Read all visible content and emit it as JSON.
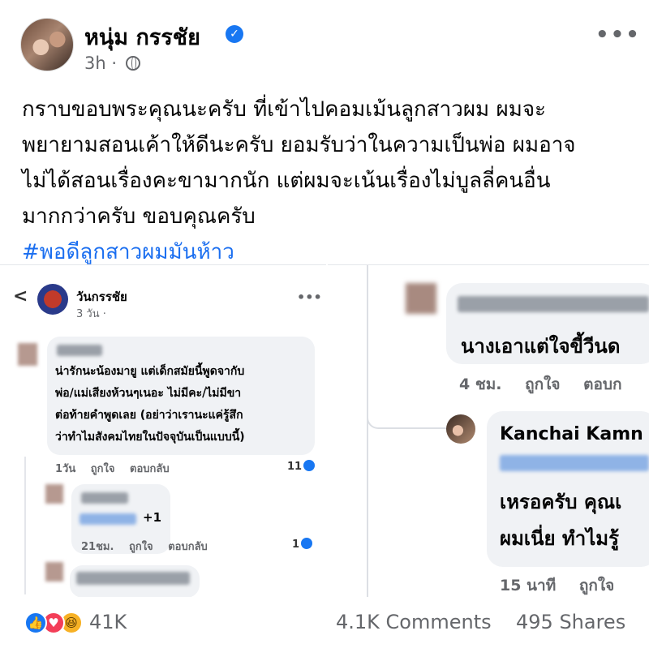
{
  "post": {
    "author": "หนุ่ม กรรชัย",
    "time": "3h",
    "separator": "·",
    "lines": [
      "กราบขอบพระคุณนะครับ ที่เข้าไปคอมเม้นลูกสาวผม ผมจะ",
      "พยายามสอนเค้าให้ดีนะครับ ยอมรับว่าในความเป็นพ่อ ผมอาจ",
      "ไม่ได้สอนเรื่องคะขามากนัก แต่ผมจะเน้นเรื่องไม่บูลลี่คนอื่น",
      "มากกว่าครับ ขอบคุณครับ"
    ],
    "hashtag": "#พอดีลูกสาวผมมันห้าว",
    "more_icon": "more-horizontal-icon",
    "verified_icon": "verified-badge-icon",
    "privacy_icon": "globe-icon"
  },
  "left_shot": {
    "back_glyph": "<",
    "page_name": "วันกรรชัย",
    "page_time": "3 วัน ·",
    "more_glyph": "•••",
    "comment1": {
      "lines": [
        "น่ารักนะน้องมายู แต่เด็กสมัยนี้พูดจากับ",
        "พ่อ/แม่เสียงห้วนๆเนอะ ไม่มีคะ/ไม่มีขา",
        "ต่อท้ายคำพูดเลย (อย่าว่าเรานะแค่รู้สึก",
        "ว่าทำไมสังคมไทยในปัจจุบันเป็นแบบนี้)"
      ],
      "time": "1วัน",
      "like": "ถูกใจ",
      "reply": "ตอบกลับ",
      "count": "11"
    },
    "comment2": {
      "text": "+1",
      "time": "21ชม.",
      "like": "ถูกใจ",
      "reply": "ตอบกลับ",
      "count": "1"
    }
  },
  "right_shot": {
    "comment1": {
      "text": "นางเอาแต่ใจขี้วีนด",
      "time": "4 ชม.",
      "like": "ถูกใจ",
      "reply": "ตอบก"
    },
    "comment2": {
      "name": "Kanchai Kamn",
      "lines": [
        "เหรอครับ คุณเ",
        "ผมเนี่ย ทำไมรู้"
      ],
      "time": "15 นาที",
      "like": "ถูกใจ"
    }
  },
  "footer": {
    "reaction_icons": [
      "like-icon",
      "love-icon",
      "haha-icon"
    ],
    "reaction_count": "41K",
    "comments": "4.1K Comments",
    "shares": "495 Shares"
  },
  "colors": {
    "hashtag": "#1a6ef0",
    "verified": "#1877f2",
    "secondary_text": "#65676b"
  }
}
